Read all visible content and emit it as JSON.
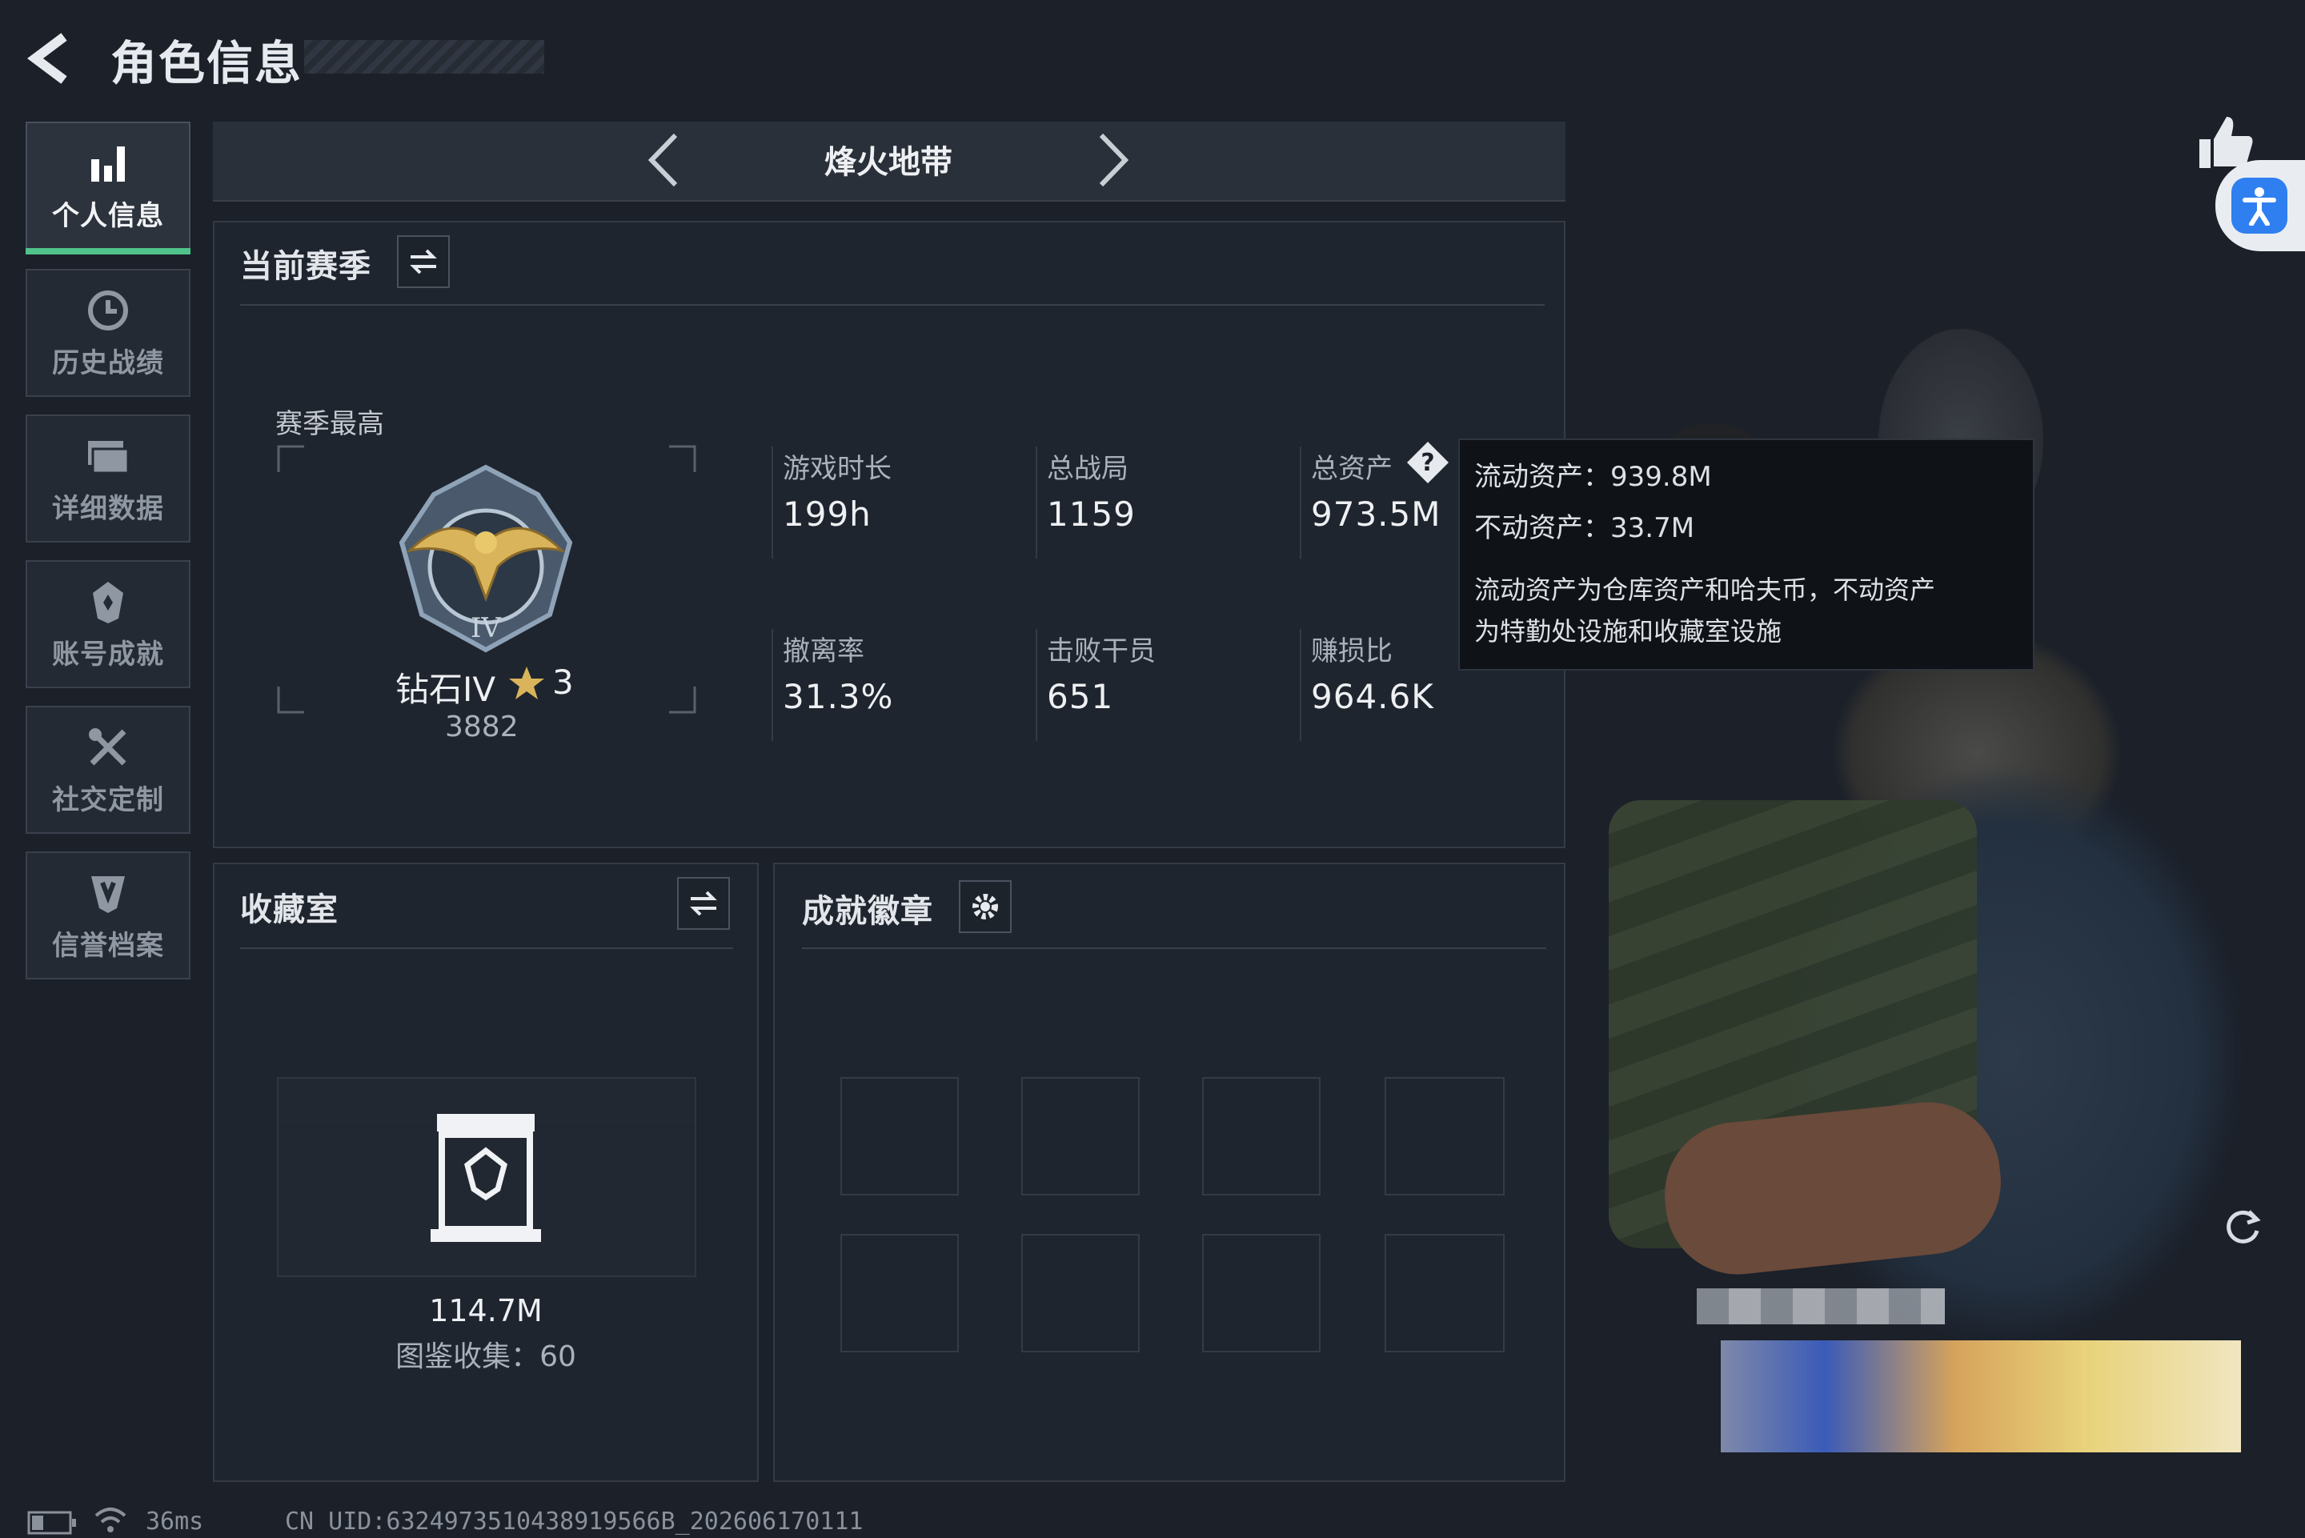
{
  "header": {
    "title": "角色信息"
  },
  "sidebar": {
    "items": [
      {
        "label": "个人信息",
        "icon": "bar-chart-icon",
        "active": true
      },
      {
        "label": "历史战绩",
        "icon": "clock-history-icon"
      },
      {
        "label": "详细数据",
        "icon": "folder-icon"
      },
      {
        "label": "账号成就",
        "icon": "medal-icon"
      },
      {
        "label": "社交定制",
        "icon": "tools-icon"
      },
      {
        "label": "信誉档案",
        "icon": "shield-badge-icon"
      }
    ]
  },
  "mode_selector": {
    "current": "烽火地带"
  },
  "season_panel": {
    "title": "当前赛季",
    "season_best_label": "赛季最高",
    "rank_name": "钻石IV",
    "rank_stars": "3",
    "rank_score": "3882",
    "stats": [
      {
        "label": "游戏时长",
        "value": "199h"
      },
      {
        "label": "总战局",
        "value": "1159"
      },
      {
        "label": "总资产",
        "value": "973.5M"
      },
      {
        "label": "撤离率",
        "value": "31.3%"
      },
      {
        "label": "击败干员",
        "value": "651"
      },
      {
        "label": "赚损比",
        "value": "964.6K"
      }
    ]
  },
  "tooltip": {
    "liquid": "流动资产：939.8M",
    "fixed": "不动资产：33.7M",
    "desc_line1": "流动资产为仓库资产和哈夫币，不动资产",
    "desc_line2": "为特勤处设施和收藏室设施"
  },
  "collection_panel": {
    "title": "收藏室",
    "value": "114.7M",
    "collection_count": "图鉴收集：60"
  },
  "badge_panel": {
    "title": "成就徽章"
  },
  "status_bar": {
    "ping": "36ms",
    "uid": "CN UID:6324973510438919566B_202606170111"
  },
  "colors": {
    "accent_green": "#4fc38a",
    "bg": "#1b2029",
    "accessibility_blue": "#2f7ff0"
  }
}
